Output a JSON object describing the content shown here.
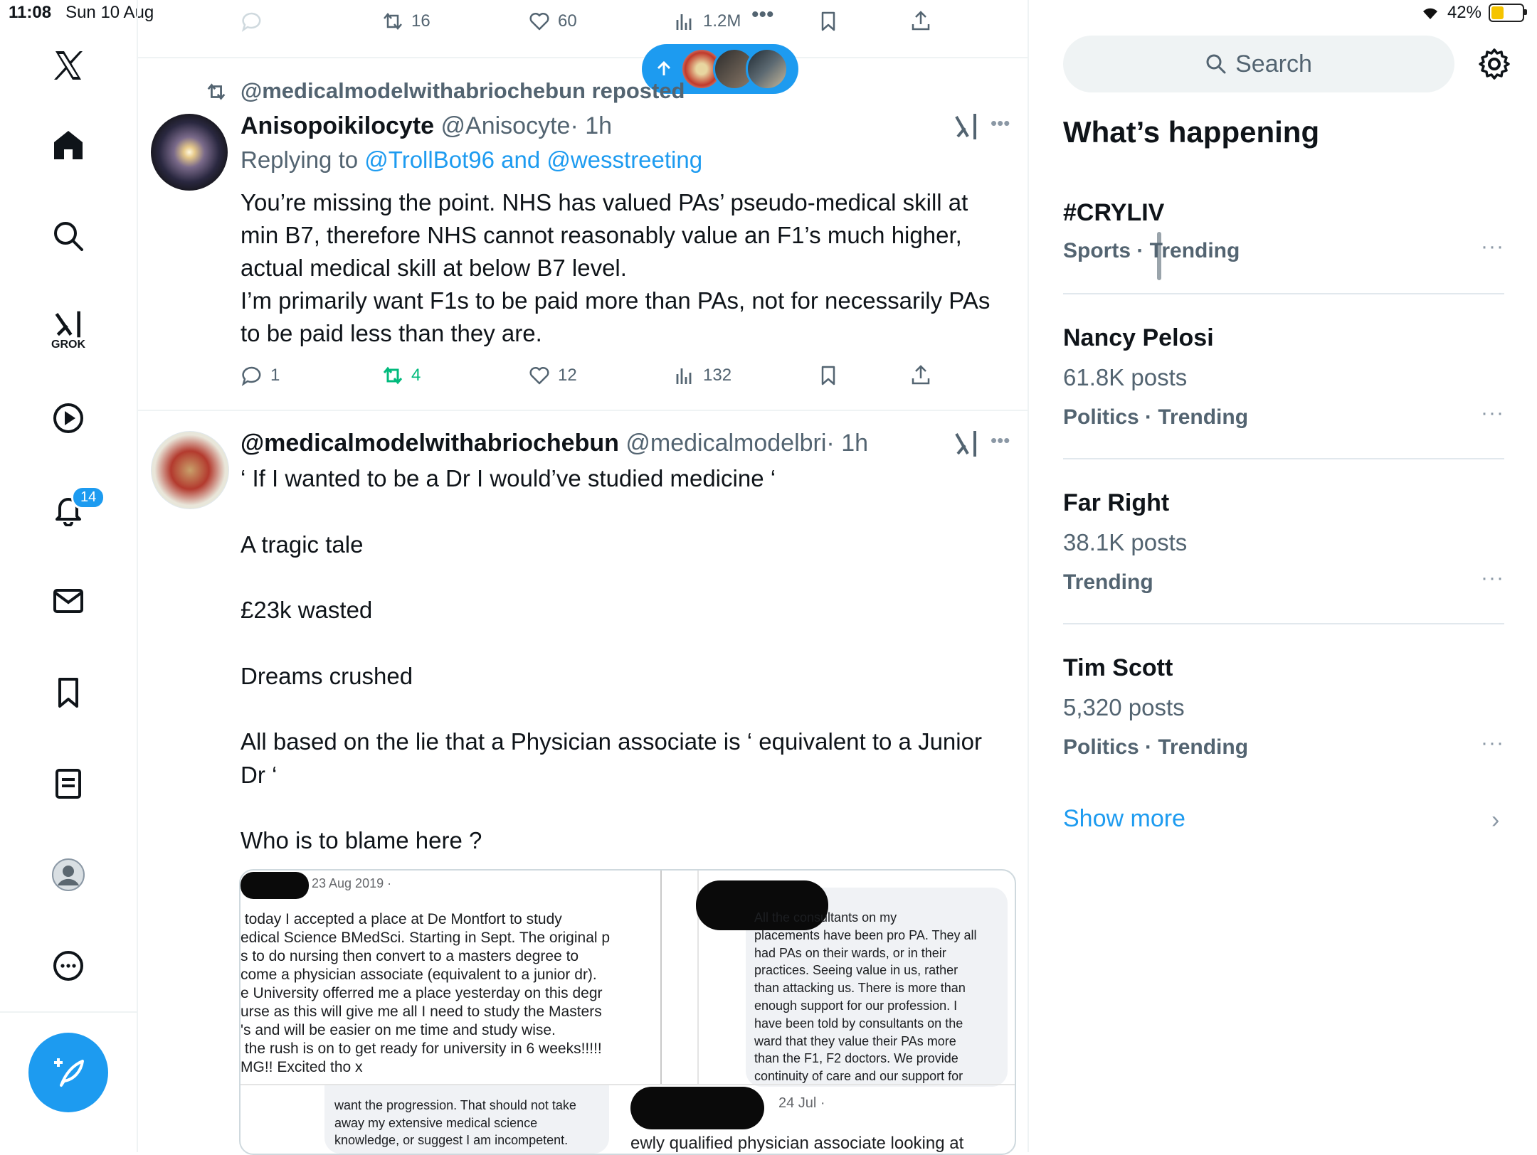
{
  "status_bar": {
    "time": "11:08",
    "date": "Sun 10 Aug",
    "battery": "42%",
    "wifi_icon": "wifi-icon",
    "battery_icon": "battery-charging-icon"
  },
  "nav": {
    "items": [
      "x-logo",
      "home",
      "explore",
      "grok",
      "video",
      "notifications",
      "messages",
      "bookmarks",
      "lists",
      "profile",
      "more"
    ],
    "grok_label": "GROK",
    "notifications_badge": "14"
  },
  "prev_tweet_actions": {
    "retweets": "16",
    "likes": "60",
    "views": "1.2M"
  },
  "tweet1": {
    "repost_line": "@medicalmodelwithabriochebun reposted",
    "name": "Anisopoikilocyte",
    "handle": "@Anisocyte",
    "time": "· 1h",
    "replying_prefix": "Replying to ",
    "replying_users": "@TrollBot96 and @wesstreeting",
    "text": "You’re missing the point. NHS has valued PAs’ pseudo-medical skill at\nmin B7, therefore NHS cannot reasonably value an F1’s much higher,\nactual medical skill at below B7 level.\nI’m primarily want F1s to be paid more than PAs, not for necessarily PAs\nto be paid less than they are.",
    "replies": "1",
    "retweets": "4",
    "likes": "12",
    "views": "132"
  },
  "tweet2": {
    "name": "@medicalmodelwithabriochebun",
    "handle": "@medicalmodelbri",
    "time": "· 1h",
    "text": "‘ If I wanted to be a Dr I would’ve studied medicine ‘\n\nA tragic tale\n\n£23k wasted\n\nDreams crushed\n\nAll based on the lie that a Physician associate is ‘ equivalent to a Junior\nDr ‘\n\nWho is to blame here ?",
    "media": {
      "left_date": "23 Aug 2019 · ",
      "left_text": " today I accepted a place at De Montfort to study\nedical Science BMedSci. Starting in Sept. The original p\ns to do nursing then convert to a masters degree to\ncome a physician associate (equivalent to a junior dr).\ne University offerred me a place yesterday on this degr\nurse as this will give me all I need to study the Masters\n's and will be easier on me time and study wise.\n the rush is on to get ready for university in 6 weeks!!!!!\nMG!! Excited tho x",
      "right_text": "All the consultants on my\nplacements have been pro PA. They all\nhad PAs on their wards, or in their\npractices. Seeing value in us, rather\nthan attacking us. There is more than\nenough support for our profession. I\nhave been told by consultants on the\nward that they value their PAs more\nthan the F1, F2 doctors. We provide\ncontinuity of care and our support for",
      "bottom_left_text": "want the progression. That should not take\naway my extensive medical science\nknowledge, or suggest I am incompetent.",
      "bottom_right_date": "24 Jul · ",
      "bottom_right_text": "ewly qualified physician associate looking at"
    }
  },
  "right": {
    "search_placeholder": "Search",
    "heading": "What’s happening",
    "trends": [
      {
        "name": "#CRYLIV",
        "count": "",
        "category": "Sports · Trending"
      },
      {
        "name": "Nancy Pelosi",
        "count": "61.8K posts",
        "category": "Politics · Trending"
      },
      {
        "name": "Far Right",
        "count": "38.1K posts",
        "category": "Trending"
      },
      {
        "name": "Tim Scott",
        "count": "5,320 posts",
        "category": "Politics · Trending"
      }
    ],
    "more_glyph": "···",
    "show_more": "Show more",
    "chevron": "›"
  },
  "colors": {
    "accent": "#1d9bf0",
    "retweet_green": "#00ba7c",
    "muted": "#536471"
  }
}
